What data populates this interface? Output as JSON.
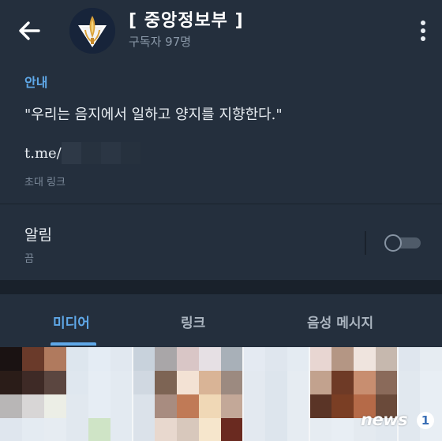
{
  "header": {
    "title": "[ 중앙정보부 ]",
    "subtitle": "구독자 97명",
    "back_icon": "arrow-left-icon",
    "more_icon": "more-vertical-icon"
  },
  "info": {
    "section_label": "안내",
    "description": "\"우리는 음지에서 일하고 양지를 지향한다.\"",
    "link_text": "t.me/",
    "link_caption": "초대 링크"
  },
  "notifications": {
    "label": "알림",
    "state": "끔",
    "toggle_on": false
  },
  "tabs": [
    {
      "label": "미디어",
      "active": true
    },
    {
      "label": "링크",
      "active": false
    },
    {
      "label": "음성 메시지",
      "active": false
    }
  ],
  "watermark": {
    "text": "news",
    "badge": "1"
  },
  "colors": {
    "background": "#1d2733",
    "panel": "#242f3d",
    "accent": "#5fa8e8",
    "text": "#e9eef3",
    "muted": "#7d8b9b"
  }
}
